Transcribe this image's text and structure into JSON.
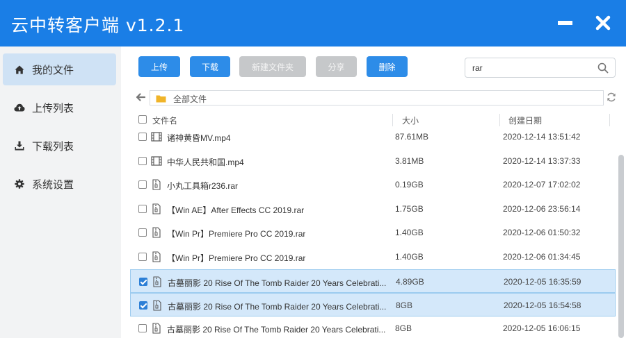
{
  "app": {
    "title": "云中转客户端 v1.2.1"
  },
  "sidebar": {
    "items": [
      {
        "label": "我的文件",
        "icon": "home-icon",
        "active": true
      },
      {
        "label": "上传列表",
        "icon": "cloud-upload-icon"
      },
      {
        "label": "下载列表",
        "icon": "download-icon"
      },
      {
        "label": "系统设置",
        "icon": "gear-icon"
      }
    ]
  },
  "toolbar": {
    "upload": "上传",
    "download": "下载",
    "new_folder": "新建文件夹",
    "share": "分享",
    "delete": "删除"
  },
  "search": {
    "value": "rar"
  },
  "path": {
    "current": "全部文件"
  },
  "table": {
    "headers": {
      "name": "文件名",
      "size": "大小",
      "date": "创建日期"
    },
    "rows": [
      {
        "name": "诸神黄昏MV.mp4",
        "size": "87.61MB",
        "date": "2020-12-14 13:51:42",
        "type": "video",
        "checked": false
      },
      {
        "name": "中华人民共和国.mp4",
        "size": "3.81MB",
        "date": "2020-12-14 13:37:33",
        "type": "video",
        "checked": false
      },
      {
        "name": "小丸工具箱r236.rar",
        "size": "0.19GB",
        "date": "2020-12-07 17:02:02",
        "type": "archive",
        "checked": false
      },
      {
        "name": "【Win AE】After Effects CC 2019.rar",
        "size": "1.75GB",
        "date": "2020-12-06 23:56:14",
        "type": "archive",
        "checked": false
      },
      {
        "name": "【Win Pr】Premiere Pro CC 2019.rar",
        "size": "1.40GB",
        "date": "2020-12-06 01:50:32",
        "type": "archive",
        "checked": false
      },
      {
        "name": "【Win Pr】Premiere Pro CC 2019.rar",
        "size": "1.40GB",
        "date": "2020-12-06 01:34:45",
        "type": "archive",
        "checked": false
      },
      {
        "name": "古墓丽影 20 Rise Of The Tomb Raider 20 Years Celebrati...",
        "size": "4.89GB",
        "date": "2020-12-05 16:35:59",
        "type": "archive",
        "checked": true
      },
      {
        "name": "古墓丽影 20 Rise Of The Tomb Raider 20 Years Celebrati...",
        "size": "8GB",
        "date": "2020-12-05 16:54:58",
        "type": "archive",
        "checked": true
      },
      {
        "name": "古墓丽影 20 Rise Of The Tomb Raider 20 Years Celebrati...",
        "size": "8GB",
        "date": "2020-12-05 16:06:15",
        "type": "archive",
        "checked": false
      }
    ]
  },
  "colors": {
    "accent": "#1a7ee6",
    "button_primary": "#2d8ce8",
    "button_disabled": "#c6c8ca",
    "selected_row": "#d4e8fa",
    "sidebar_bg": "#f2f3f4",
    "sidebar_active": "#cfe2f5"
  }
}
